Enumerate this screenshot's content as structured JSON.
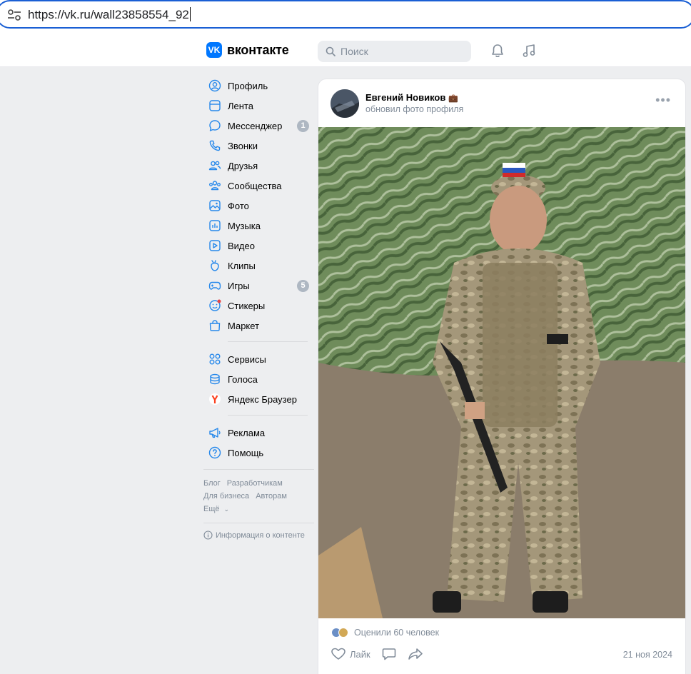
{
  "browser": {
    "url": "https://vk.ru/wall23858554_92"
  },
  "header": {
    "logo_mark": "VK",
    "logo_text": "вконтакте",
    "search_placeholder": "Поиск",
    "accent": "#0077ff"
  },
  "sidebar": {
    "items": [
      {
        "label": "Профиль",
        "icon": "profile-icon"
      },
      {
        "label": "Лента",
        "icon": "feed-icon"
      },
      {
        "label": "Мессенджер",
        "icon": "messenger-icon",
        "badge": "1"
      },
      {
        "label": "Звонки",
        "icon": "phone-icon"
      },
      {
        "label": "Друзья",
        "icon": "friends-icon"
      },
      {
        "label": "Сообщества",
        "icon": "communities-icon"
      },
      {
        "label": "Фото",
        "icon": "photo-icon"
      },
      {
        "label": "Музыка",
        "icon": "music-icon"
      },
      {
        "label": "Видео",
        "icon": "video-icon"
      },
      {
        "label": "Клипы",
        "icon": "clips-icon"
      },
      {
        "label": "Игры",
        "icon": "games-icon",
        "badge": "5"
      },
      {
        "label": "Стикеры",
        "icon": "stickers-icon"
      },
      {
        "label": "Маркет",
        "icon": "market-icon"
      }
    ],
    "items2": [
      {
        "label": "Сервисы",
        "icon": "services-icon"
      },
      {
        "label": "Голоса",
        "icon": "votes-icon"
      },
      {
        "label": "Яндекс Браузер",
        "icon": "yandex-icon"
      }
    ],
    "items3": [
      {
        "label": "Реклама",
        "icon": "ads-icon"
      },
      {
        "label": "Помощь",
        "icon": "help-icon"
      }
    ],
    "footer": {
      "blog": "Блог",
      "developers": "Разработчикам",
      "business": "Для бизнеса",
      "authors": "Авторам",
      "more": "Ещё",
      "content_info": "Информация о контенте"
    }
  },
  "post": {
    "author": "Евгений Новиков",
    "author_emoji": "💼",
    "subtitle": "обновил фото профиля",
    "likes_text": "Оценили 60 человек",
    "like_label": "Лайк",
    "date": "21 ноя 2024"
  }
}
